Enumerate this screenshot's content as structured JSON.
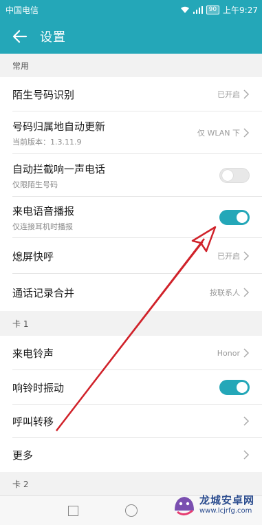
{
  "status_bar": {
    "carrier": "中国电信",
    "battery": "90",
    "time": "上午9:27"
  },
  "app_bar": {
    "title": "设置"
  },
  "sections": {
    "common": "常用",
    "card1": "卡 1",
    "card2": "卡 2"
  },
  "rows": {
    "unknown_number_id": {
      "title": "陌生号码识别",
      "value": "已开启"
    },
    "location_update": {
      "title": "号码归属地自动更新",
      "sub": "当前版本：1.3.11.9",
      "value": "仅 WLAN 下"
    },
    "auto_block": {
      "title": "自动拦截响一声电话",
      "sub": "仅限陌生号码",
      "on": false
    },
    "voice_announce": {
      "title": "来电语音播报",
      "sub": "仅连接耳机时播报",
      "on": true
    },
    "screen_off_call": {
      "title": "熄屏快呼",
      "value": "已开启"
    },
    "merge_logs": {
      "title": "通话记录合并",
      "value": "按联系人"
    },
    "ringtone": {
      "title": "来电铃声",
      "value": "Honor"
    },
    "vibrate": {
      "title": "响铃时振动",
      "on": true
    },
    "call_forward": {
      "title": "呼叫转移"
    },
    "more": {
      "title": "更多"
    }
  },
  "watermark": {
    "title": "龙城安卓网",
    "url": "www.lcjrfg.com"
  },
  "colors": {
    "accent": "#24a7b8",
    "annotation_arrow": "#d0222a"
  }
}
